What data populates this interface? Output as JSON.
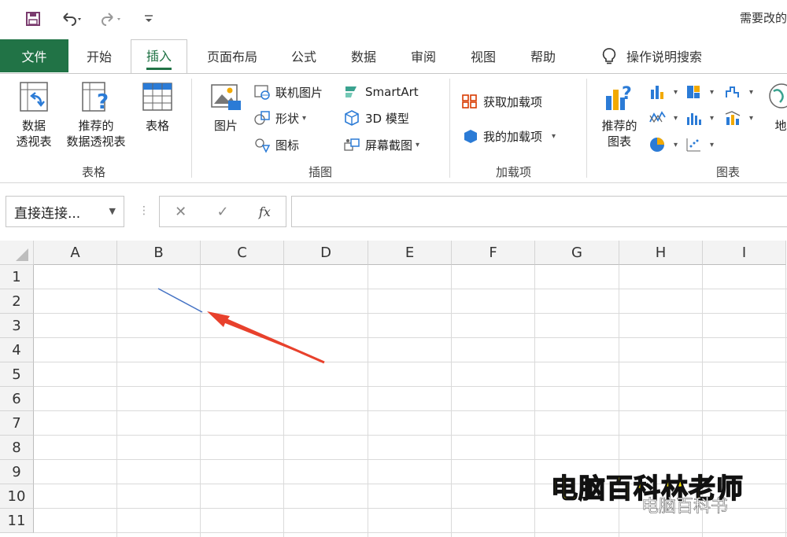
{
  "qat": {
    "save_icon": "save-icon",
    "undo_icon": "undo-icon",
    "redo_icon": "redo-icon",
    "customize_icon": "customize-icon"
  },
  "window": {
    "doc_title": "需要改的"
  },
  "tabs": [
    {
      "label": "文件"
    },
    {
      "label": "开始"
    },
    {
      "label": "插入"
    },
    {
      "label": "页面布局"
    },
    {
      "label": "公式"
    },
    {
      "label": "数据"
    },
    {
      "label": "审阅"
    },
    {
      "label": "视图"
    },
    {
      "label": "帮助"
    }
  ],
  "tell_me": "操作说明搜索",
  "ribbon": {
    "tables": {
      "pivot_line1": "数据",
      "pivot_line2": "透视表",
      "rec_pivot_line1": "推荐的",
      "rec_pivot_line2": "数据透视表",
      "table": "表格",
      "group": "表格"
    },
    "illustrations": {
      "picture": "图片",
      "online_pic": "联机图片",
      "shapes": "形状",
      "icons": "图标",
      "smartart": "SmartArt",
      "model3d": "3D 模型",
      "screenshot": "屏幕截图",
      "group": "插图"
    },
    "addins": {
      "get": "获取加载项",
      "mine": "我的加载项",
      "group": "加载项"
    },
    "charts": {
      "rec_line1": "推荐的",
      "rec_line2": "图表",
      "map": "地",
      "group": "图表"
    }
  },
  "formula_bar": {
    "name_box": "直接连接...",
    "cancel": "✕",
    "enter": "✓",
    "fx": "fx"
  },
  "columns": [
    "A",
    "B",
    "C",
    "D",
    "E",
    "F",
    "G",
    "H",
    "I"
  ],
  "rows": [
    "1",
    "2",
    "3",
    "4",
    "5",
    "6",
    "7",
    "8",
    "9",
    "10",
    "11"
  ],
  "watermark": {
    "main": "电脑百科林老师",
    "sub": "电脑百科书"
  },
  "colors": {
    "accent": "#217346",
    "arrow": "#e8412c",
    "line": "#4472c4"
  }
}
